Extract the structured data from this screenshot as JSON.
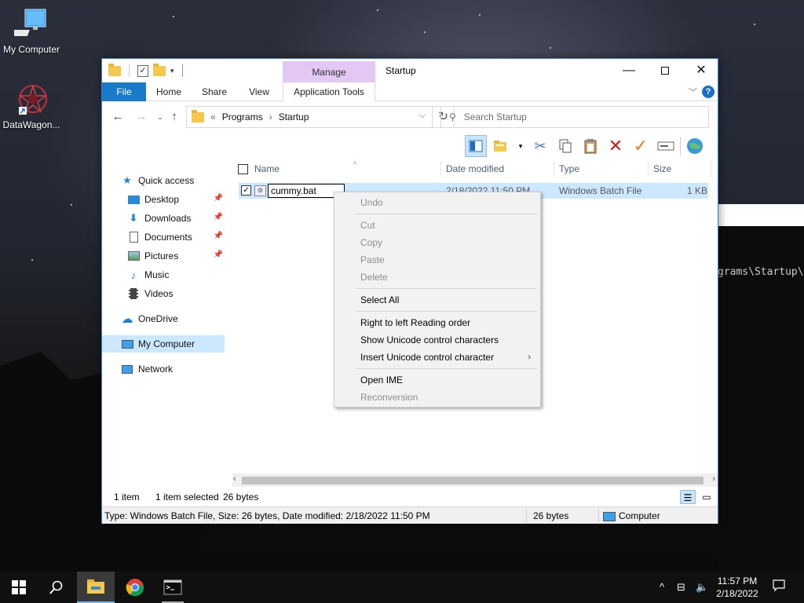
{
  "desktop": {
    "icons": [
      {
        "label": "My Computer",
        "icon": "computer-icon"
      },
      {
        "label": "DataWagon...",
        "icon": "datawagon-shortcut-icon"
      }
    ]
  },
  "terminal": {
    "text": "grams\\Startup\\"
  },
  "explorer": {
    "title": "Startup",
    "contextual_group": "Manage",
    "ribbon_tabs": {
      "file": "File",
      "home": "Home",
      "share": "Share",
      "view": "View",
      "app_tools": "Application Tools"
    },
    "address": {
      "prefix": "«",
      "crumbs": [
        "Programs",
        "Startup"
      ],
      "separator": "›"
    },
    "search": {
      "placeholder": "Search Startup"
    },
    "nav_pane": {
      "quick_access": "Quick access",
      "desktop": "Desktop",
      "downloads": "Downloads",
      "documents": "Documents",
      "pictures": "Pictures",
      "music": "Music",
      "videos": "Videos",
      "onedrive": "OneDrive",
      "my_computer": "My Computer",
      "network": "Network"
    },
    "columns": {
      "name": "Name",
      "date": "Date modified",
      "type": "Type",
      "size": "Size"
    },
    "file": {
      "name": "cummy.bat",
      "date": "2/18/2022 11:50 PM",
      "type": "Windows Batch File",
      "size": "1 KB"
    },
    "status": {
      "item_count": "1 item",
      "selected": "1 item selected",
      "bytes": "26 bytes",
      "details": "Type: Windows Batch File, Size: 26 bytes, Date modified: 2/18/2022 11:50 PM",
      "size_right": "26 bytes",
      "location": "Computer"
    }
  },
  "context_menu": {
    "undo": "Undo",
    "cut": "Cut",
    "copy": "Copy",
    "paste": "Paste",
    "delete": "Delete",
    "select_all": "Select All",
    "rtl": "Right to left Reading order",
    "show_unicode": "Show Unicode control characters",
    "insert_unicode": "Insert Unicode control character",
    "open_ime": "Open IME",
    "reconversion": "Reconversion"
  },
  "taskbar": {
    "time": "11:57 PM",
    "date": "2/18/2022"
  },
  "colors": {
    "accent": "#1979ca",
    "manage_tab": "#e3c7f5",
    "selection": "#cce8ff",
    "delete_red": "#d11a1a",
    "check_orange": "#e07b1a"
  }
}
